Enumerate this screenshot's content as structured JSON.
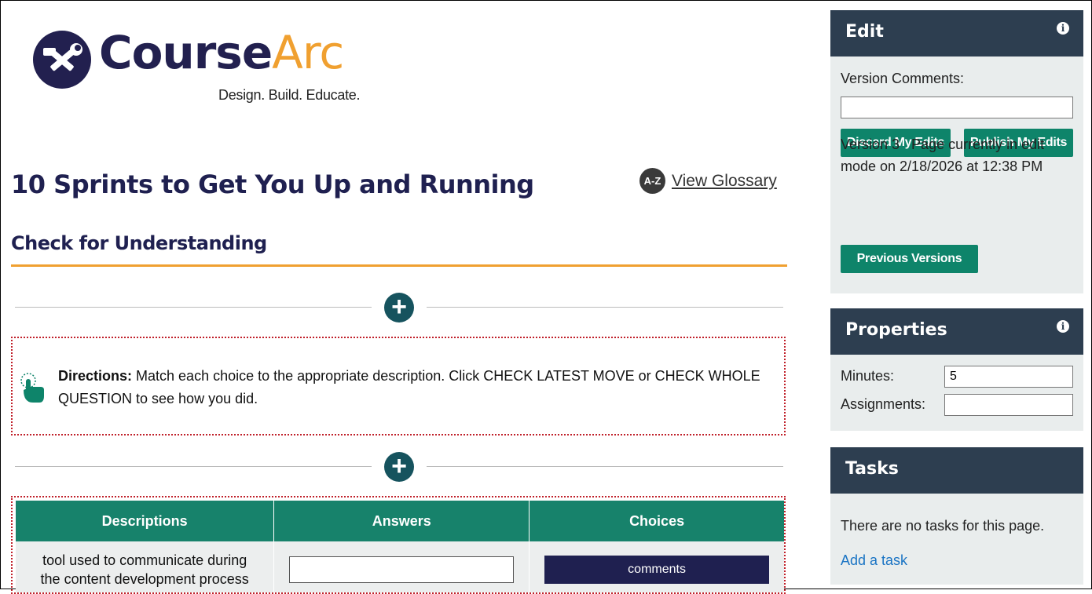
{
  "logo": {
    "brand_first": "Course",
    "brand_second": "Arc",
    "tagline": "Design. Build. Educate."
  },
  "page": {
    "title": "10 Sprints to Get You Up and Running"
  },
  "glossary": {
    "icon_text": "A-Z",
    "label": "View Glossary"
  },
  "section": {
    "heading": "Check for Understanding"
  },
  "directions": {
    "label": "Directions:",
    "text": " Match each choice to the appropriate description. Click CHECK LATEST MOVE or CHECK WHOLE QUESTION to see how you did."
  },
  "add_button": {
    "glyph": "+"
  },
  "match_table": {
    "headers": [
      "Descriptions",
      "Answers",
      "Choices"
    ],
    "rows": [
      {
        "description": "tool used to communicate during the content development process",
        "answer": "",
        "choice": "comments"
      }
    ]
  },
  "edit_panel": {
    "title": "Edit",
    "info_glyph": "i",
    "version_comments_label": "Version Comments:",
    "version_comments_value": "",
    "discard_label": "Discard My Edits",
    "publish_label": "Publish My Edits",
    "version_status": "Version 3   Page currently in edit mode on 2/18/2026 at 12:38 PM",
    "previous_versions_label": "Previous Versions"
  },
  "properties_panel": {
    "title": "Properties",
    "info_glyph": "i",
    "minutes_label": "Minutes:",
    "minutes_value": "5",
    "assignments_label": "Assignments:",
    "assignments_value": ""
  },
  "tasks_panel": {
    "title": "Tasks",
    "empty_text": "There are no tasks for this page.",
    "add_task_label": "Add a task"
  },
  "colors": {
    "navy": "#1f2050",
    "orange_accent": "#f0a030",
    "teal_button": "#0e846a",
    "table_header": "#17826b",
    "panel_header": "#2d3e50",
    "link": "#1a74c4"
  },
  "icons": [
    "hammer-wrench-logo-icon",
    "a-z-glossary-icon",
    "plus-icon",
    "tap-hand-icon",
    "info-icon"
  ]
}
